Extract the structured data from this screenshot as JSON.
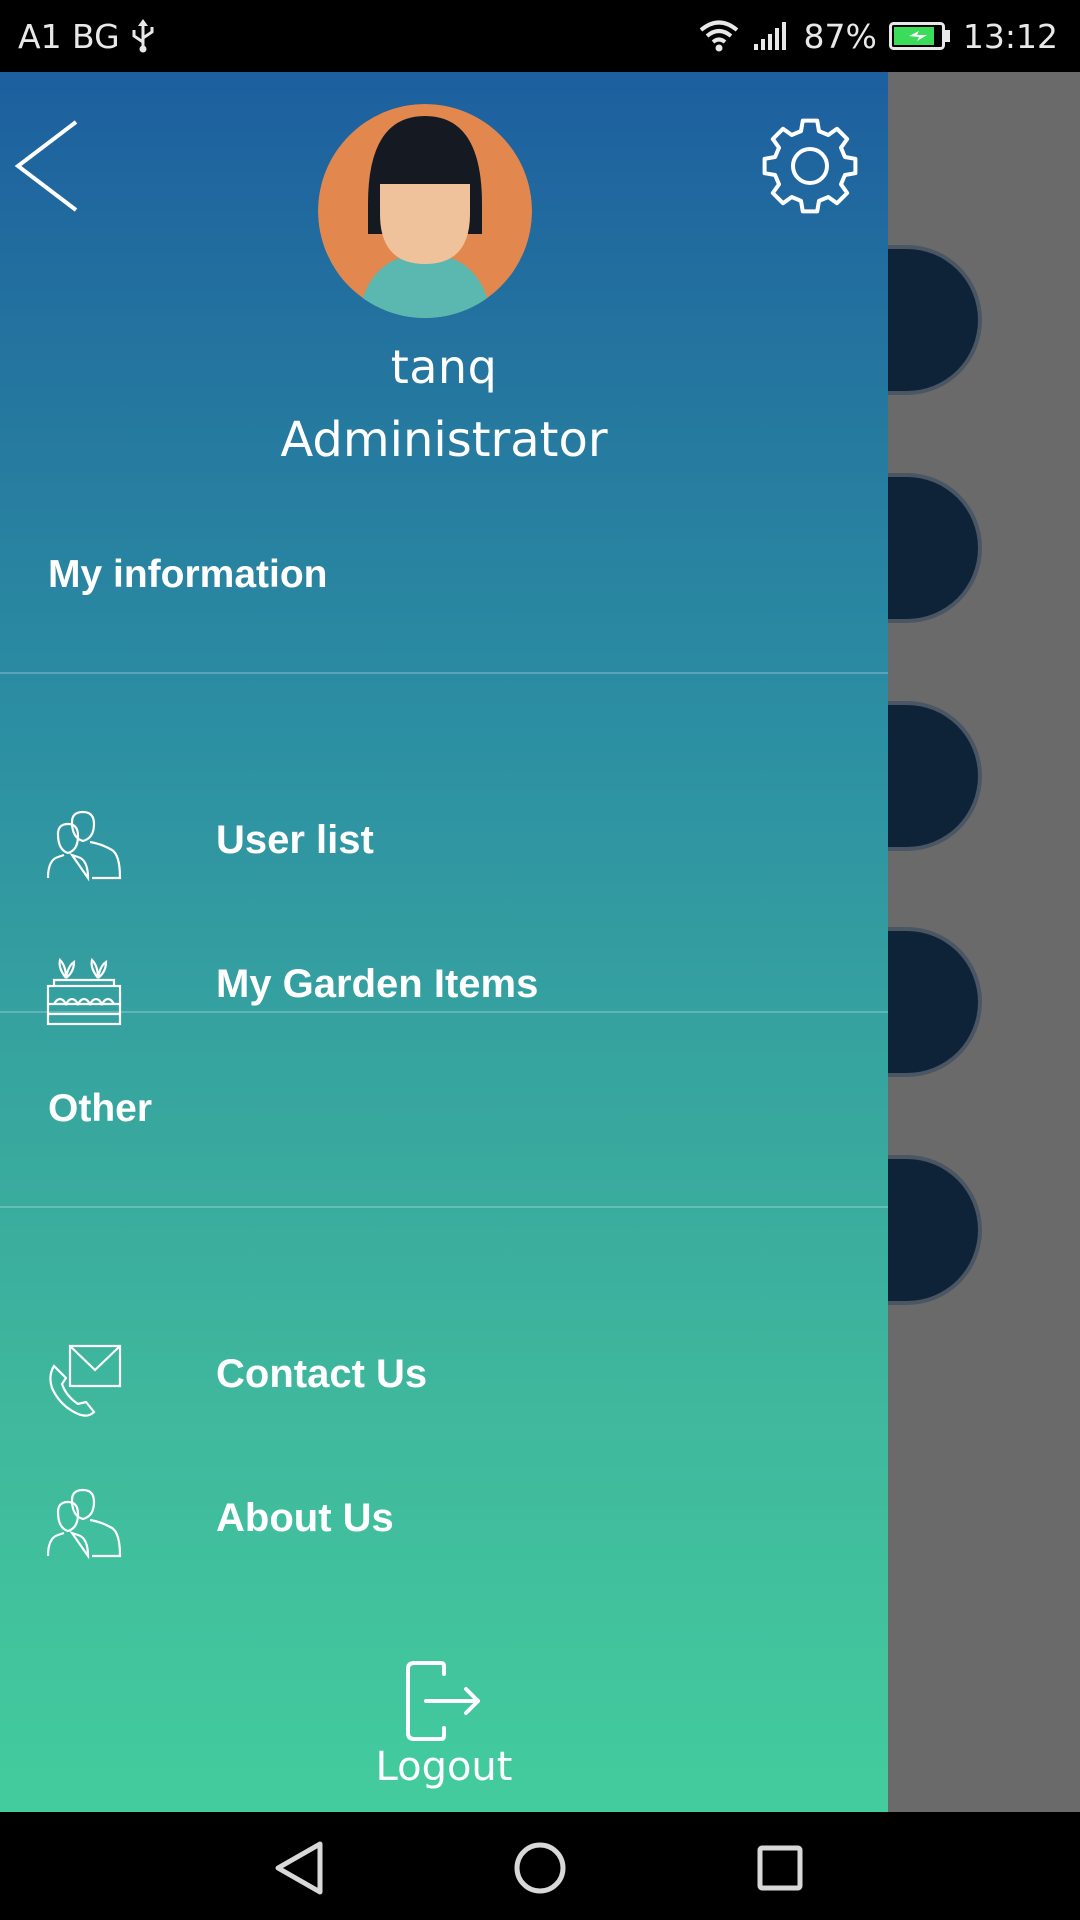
{
  "status_bar": {
    "carrier": "A1 BG",
    "usb_icon": "usb-icon",
    "wifi_icon": "wifi-icon",
    "signal_icon": "signal-icon",
    "battery_percent": "87%",
    "battery_level": 0.87,
    "time": "13:12"
  },
  "drawer": {
    "back_icon": "chevron-left-icon",
    "settings_icon": "gear-icon",
    "user": {
      "name": "tanq",
      "role": "Administrator",
      "avatar_icon": "avatar-icon"
    },
    "sections": [
      {
        "heading": "My information",
        "items": [
          {
            "label": "User list",
            "icon": "users-icon"
          },
          {
            "label": "My Garden Items",
            "icon": "garden-icon"
          }
        ]
      },
      {
        "heading": "Other",
        "items": [
          {
            "label": "Contact Us",
            "icon": "contact-icon"
          },
          {
            "label": "About Us",
            "icon": "users-icon"
          }
        ]
      }
    ],
    "logout": {
      "label": "Logout",
      "icon": "logout-icon"
    }
  },
  "nav_bar": {
    "back_icon": "nav-back-icon",
    "home_icon": "nav-home-icon",
    "recents_icon": "nav-recents-icon"
  },
  "colors": {
    "gradient_top": "#1d5f9f",
    "gradient_bottom": "#43cc9d",
    "avatar_bg": "#e2874e",
    "battery_fill": "#3bdc5a"
  }
}
